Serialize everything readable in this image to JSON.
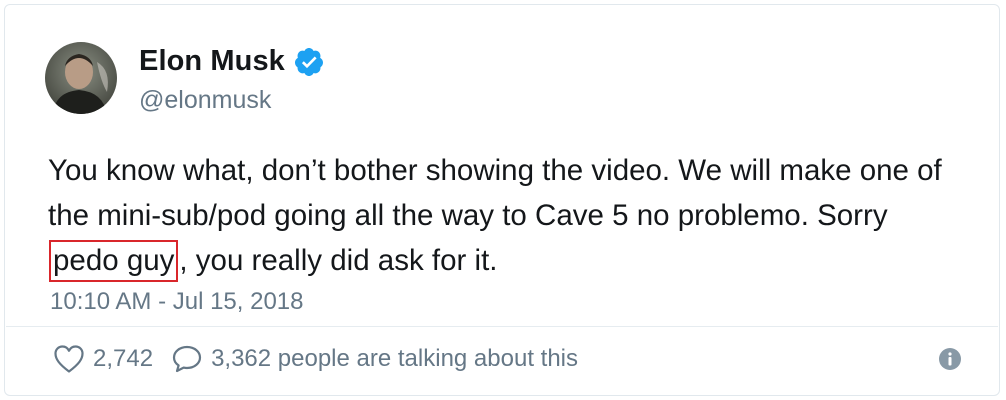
{
  "user": {
    "name": "Elon Musk",
    "handle": "@elonmusk",
    "verified": true,
    "avatar_icon": "profile-photo"
  },
  "tweet": {
    "text_before": "You know what, don’t bother showing the video. We will make one of the mini-sub/pod going all the way to Cave 5 no problemo. Sorry ",
    "highlighted": "pedo guy",
    "text_after": ", you really did ask for it.",
    "timestamp": "10:10 AM - Jul 15, 2018",
    "highlight_color": "#d9262b"
  },
  "stats": {
    "likes": "2,742",
    "talking": "3,362 people are talking about this",
    "like_icon": "heart-icon",
    "reply_icon": "speech-bubble-icon",
    "info_icon": "info-icon"
  },
  "colors": {
    "verified_blue": "#1da1f2",
    "text_primary": "#14171a",
    "text_secondary": "#657786"
  }
}
